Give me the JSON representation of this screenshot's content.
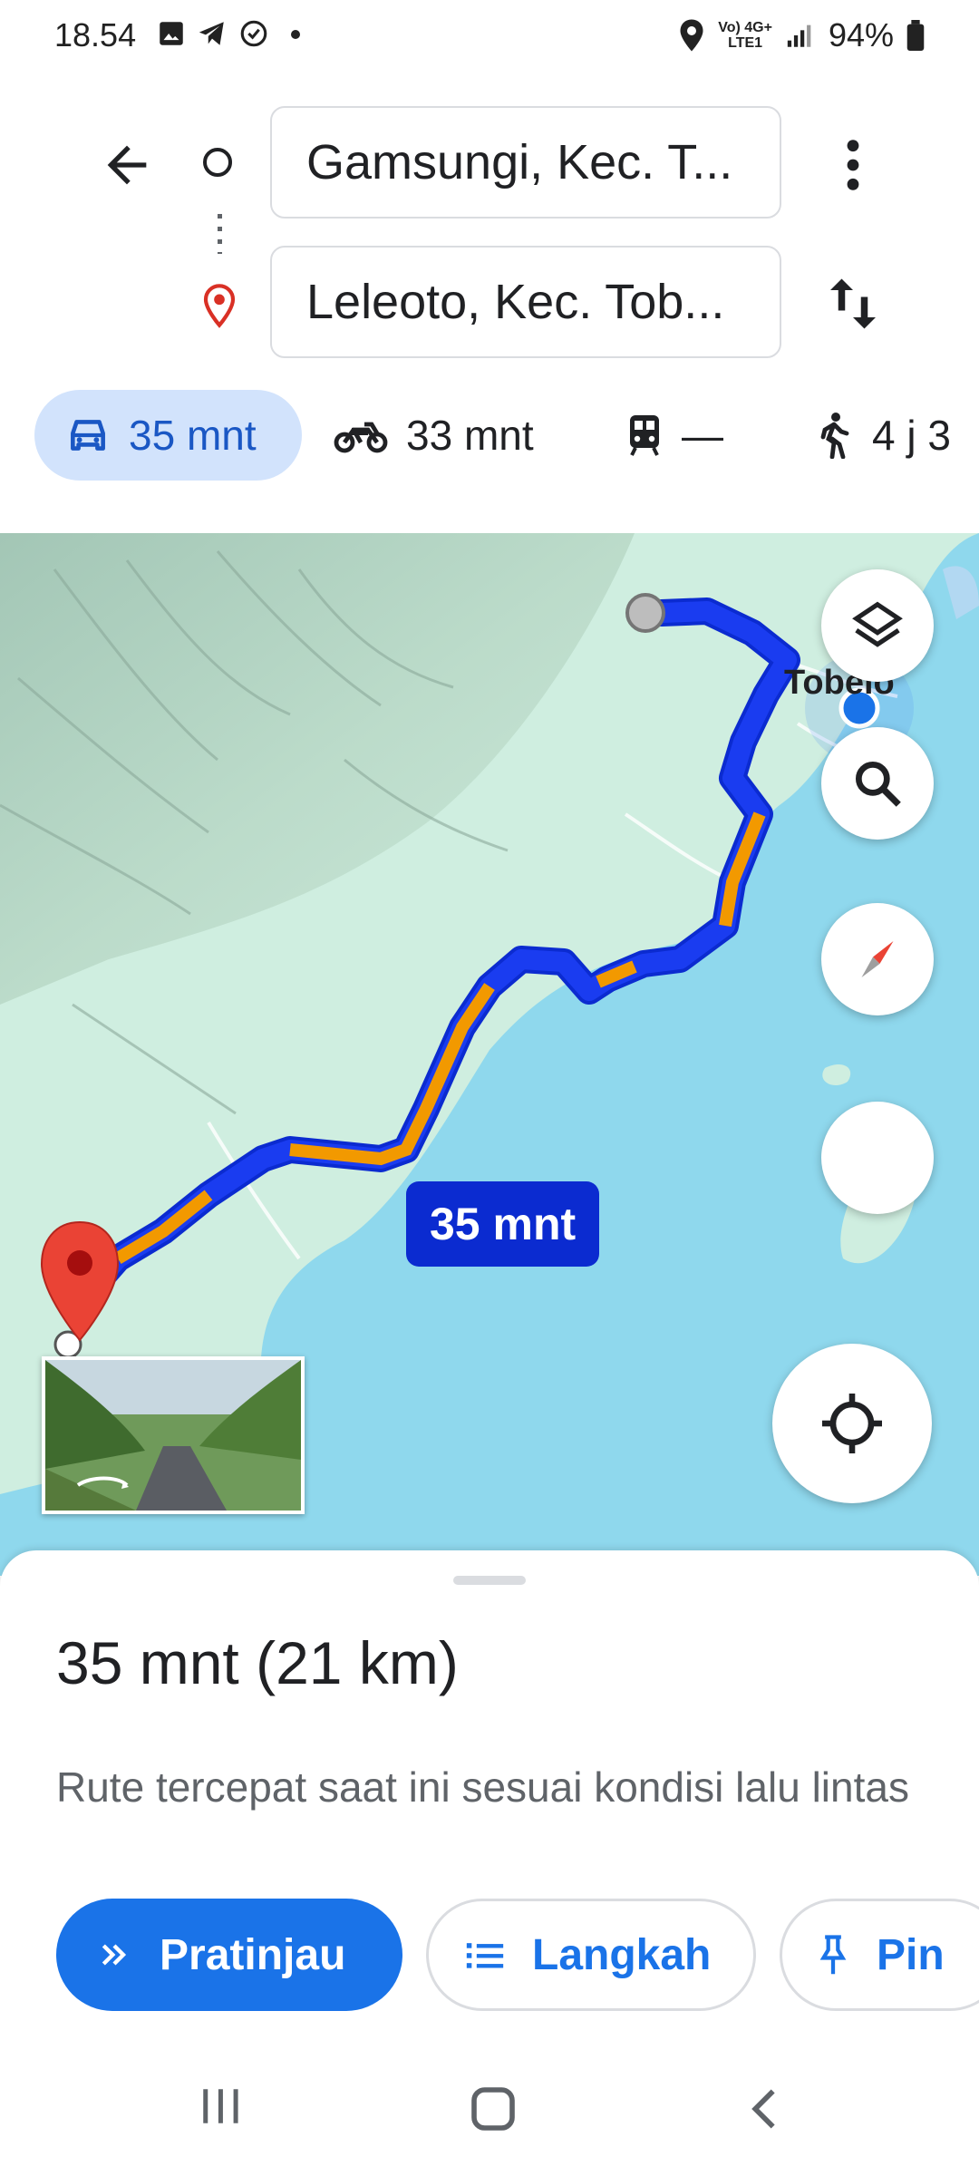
{
  "status_bar": {
    "time": "18.54",
    "network_top": "Vo) 4G+",
    "network_bottom": "LTE1",
    "battery": "94%",
    "icons": [
      "image-icon",
      "telegram-icon",
      "verified-icon",
      "dot-icon",
      "location-icon",
      "signal-icon",
      "battery-icon"
    ]
  },
  "header": {
    "origin": "Gamsungi, Kec. T...",
    "destination": "Leleoto, Kec. Tob..."
  },
  "modes": [
    {
      "name": "car",
      "label": "35 mnt",
      "selected": true
    },
    {
      "name": "motorcycle",
      "label": "33 mnt",
      "selected": false
    },
    {
      "name": "transit",
      "label": "—",
      "selected": false
    },
    {
      "name": "walk",
      "label": "4 j 3",
      "selected": false
    }
  ],
  "map": {
    "route_label": "35 mnt",
    "town_label": "Tobelo",
    "colors": {
      "route": "#1a3cf0",
      "traffic": "#f29900",
      "water": "#8fd8ed",
      "land": "#cfeee0"
    }
  },
  "summary": {
    "duration": "35 mnt",
    "distance": "(21 km)",
    "description": "Rute tercepat saat ini sesuai kondisi lalu lintas"
  },
  "actions": {
    "preview": "Pratinjau",
    "steps": "Langkah",
    "pin": "Pin"
  },
  "colors": {
    "accent": "#1a73e8",
    "selected_tab_bg": "#d2e3fc"
  }
}
